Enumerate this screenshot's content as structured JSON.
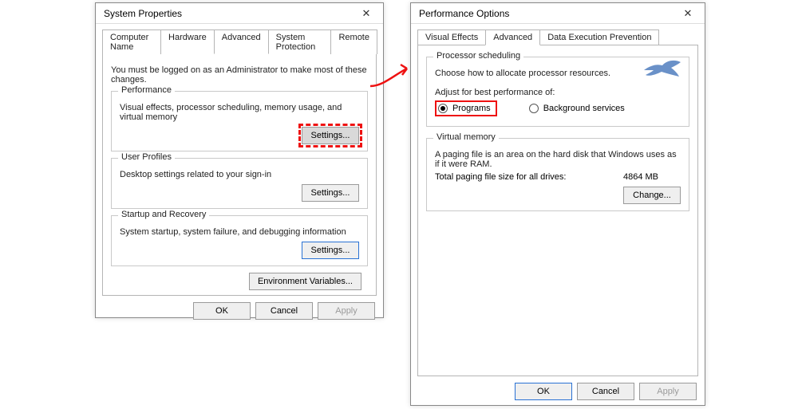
{
  "sysprops": {
    "title": "System Properties",
    "tabs": {
      "computer_name": "Computer Name",
      "hardware": "Hardware",
      "advanced": "Advanced",
      "system_protection": "System Protection",
      "remote": "Remote"
    },
    "lead": "You must be logged on as an Administrator to make most of these changes.",
    "performance": {
      "legend": "Performance",
      "desc": "Visual effects, processor scheduling, memory usage, and virtual memory",
      "settings_btn": "Settings..."
    },
    "user_profiles": {
      "legend": "User Profiles",
      "desc": "Desktop settings related to your sign-in",
      "settings_btn": "Settings..."
    },
    "startup": {
      "legend": "Startup and Recovery",
      "desc": "System startup, system failure, and debugging information",
      "settings_btn": "Settings..."
    },
    "env_btn": "Environment Variables...",
    "ok": "OK",
    "cancel": "Cancel",
    "apply": "Apply"
  },
  "perfopts": {
    "title": "Performance Options",
    "tabs": {
      "visual_effects": "Visual Effects",
      "advanced": "Advanced",
      "dep": "Data Execution Prevention"
    },
    "proc": {
      "legend": "Processor scheduling",
      "desc": "Choose how to allocate processor resources.",
      "adjust_label": "Adjust for best performance of:",
      "programs": "Programs",
      "bgservices": "Background services"
    },
    "vm": {
      "legend": "Virtual memory",
      "desc": "A paging file is an area on the hard disk that Windows uses as if it were RAM.",
      "total_label": "Total paging file size for all drives:",
      "total_value": "4864 MB",
      "change_btn": "Change..."
    },
    "ok": "OK",
    "cancel": "Cancel",
    "apply": "Apply"
  }
}
